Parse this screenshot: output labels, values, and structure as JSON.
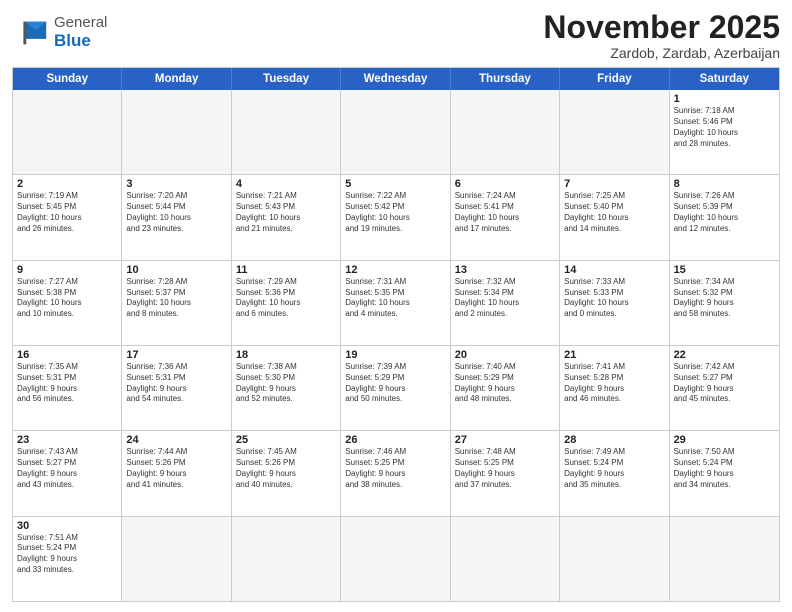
{
  "logo": {
    "general": "General",
    "blue": "Blue"
  },
  "title": {
    "month": "November 2025",
    "location": "Zardob, Zardab, Azerbaijan"
  },
  "weekdays": [
    "Sunday",
    "Monday",
    "Tuesday",
    "Wednesday",
    "Thursday",
    "Friday",
    "Saturday"
  ],
  "rows": [
    [
      {
        "day": "",
        "info": "",
        "empty": true
      },
      {
        "day": "",
        "info": "",
        "empty": true
      },
      {
        "day": "",
        "info": "",
        "empty": true
      },
      {
        "day": "",
        "info": "",
        "empty": true
      },
      {
        "day": "",
        "info": "",
        "empty": true
      },
      {
        "day": "",
        "info": "",
        "empty": true
      },
      {
        "day": "1",
        "info": "Sunrise: 7:18 AM\nSunset: 5:46 PM\nDaylight: 10 hours\nand 28 minutes.",
        "empty": false
      }
    ],
    [
      {
        "day": "2",
        "info": "Sunrise: 7:19 AM\nSunset: 5:45 PM\nDaylight: 10 hours\nand 26 minutes.",
        "empty": false
      },
      {
        "day": "3",
        "info": "Sunrise: 7:20 AM\nSunset: 5:44 PM\nDaylight: 10 hours\nand 23 minutes.",
        "empty": false
      },
      {
        "day": "4",
        "info": "Sunrise: 7:21 AM\nSunset: 5:43 PM\nDaylight: 10 hours\nand 21 minutes.",
        "empty": false
      },
      {
        "day": "5",
        "info": "Sunrise: 7:22 AM\nSunset: 5:42 PM\nDaylight: 10 hours\nand 19 minutes.",
        "empty": false
      },
      {
        "day": "6",
        "info": "Sunrise: 7:24 AM\nSunset: 5:41 PM\nDaylight: 10 hours\nand 17 minutes.",
        "empty": false
      },
      {
        "day": "7",
        "info": "Sunrise: 7:25 AM\nSunset: 5:40 PM\nDaylight: 10 hours\nand 14 minutes.",
        "empty": false
      },
      {
        "day": "8",
        "info": "Sunrise: 7:26 AM\nSunset: 5:39 PM\nDaylight: 10 hours\nand 12 minutes.",
        "empty": false
      }
    ],
    [
      {
        "day": "9",
        "info": "Sunrise: 7:27 AM\nSunset: 5:38 PM\nDaylight: 10 hours\nand 10 minutes.",
        "empty": false
      },
      {
        "day": "10",
        "info": "Sunrise: 7:28 AM\nSunset: 5:37 PM\nDaylight: 10 hours\nand 8 minutes.",
        "empty": false
      },
      {
        "day": "11",
        "info": "Sunrise: 7:29 AM\nSunset: 5:36 PM\nDaylight: 10 hours\nand 6 minutes.",
        "empty": false
      },
      {
        "day": "12",
        "info": "Sunrise: 7:31 AM\nSunset: 5:35 PM\nDaylight: 10 hours\nand 4 minutes.",
        "empty": false
      },
      {
        "day": "13",
        "info": "Sunrise: 7:32 AM\nSunset: 5:34 PM\nDaylight: 10 hours\nand 2 minutes.",
        "empty": false
      },
      {
        "day": "14",
        "info": "Sunrise: 7:33 AM\nSunset: 5:33 PM\nDaylight: 10 hours\nand 0 minutes.",
        "empty": false
      },
      {
        "day": "15",
        "info": "Sunrise: 7:34 AM\nSunset: 5:32 PM\nDaylight: 9 hours\nand 58 minutes.",
        "empty": false
      }
    ],
    [
      {
        "day": "16",
        "info": "Sunrise: 7:35 AM\nSunset: 5:31 PM\nDaylight: 9 hours\nand 56 minutes.",
        "empty": false
      },
      {
        "day": "17",
        "info": "Sunrise: 7:36 AM\nSunset: 5:31 PM\nDaylight: 9 hours\nand 54 minutes.",
        "empty": false
      },
      {
        "day": "18",
        "info": "Sunrise: 7:38 AM\nSunset: 5:30 PM\nDaylight: 9 hours\nand 52 minutes.",
        "empty": false
      },
      {
        "day": "19",
        "info": "Sunrise: 7:39 AM\nSunset: 5:29 PM\nDaylight: 9 hours\nand 50 minutes.",
        "empty": false
      },
      {
        "day": "20",
        "info": "Sunrise: 7:40 AM\nSunset: 5:29 PM\nDaylight: 9 hours\nand 48 minutes.",
        "empty": false
      },
      {
        "day": "21",
        "info": "Sunrise: 7:41 AM\nSunset: 5:28 PM\nDaylight: 9 hours\nand 46 minutes.",
        "empty": false
      },
      {
        "day": "22",
        "info": "Sunrise: 7:42 AM\nSunset: 5:27 PM\nDaylight: 9 hours\nand 45 minutes.",
        "empty": false
      }
    ],
    [
      {
        "day": "23",
        "info": "Sunrise: 7:43 AM\nSunset: 5:27 PM\nDaylight: 9 hours\nand 43 minutes.",
        "empty": false
      },
      {
        "day": "24",
        "info": "Sunrise: 7:44 AM\nSunset: 5:26 PM\nDaylight: 9 hours\nand 41 minutes.",
        "empty": false
      },
      {
        "day": "25",
        "info": "Sunrise: 7:45 AM\nSunset: 5:26 PM\nDaylight: 9 hours\nand 40 minutes.",
        "empty": false
      },
      {
        "day": "26",
        "info": "Sunrise: 7:46 AM\nSunset: 5:25 PM\nDaylight: 9 hours\nand 38 minutes.",
        "empty": false
      },
      {
        "day": "27",
        "info": "Sunrise: 7:48 AM\nSunset: 5:25 PM\nDaylight: 9 hours\nand 37 minutes.",
        "empty": false
      },
      {
        "day": "28",
        "info": "Sunrise: 7:49 AM\nSunset: 5:24 PM\nDaylight: 9 hours\nand 35 minutes.",
        "empty": false
      },
      {
        "day": "29",
        "info": "Sunrise: 7:50 AM\nSunset: 5:24 PM\nDaylight: 9 hours\nand 34 minutes.",
        "empty": false
      }
    ],
    [
      {
        "day": "30",
        "info": "Sunrise: 7:51 AM\nSunset: 5:24 PM\nDaylight: 9 hours\nand 33 minutes.",
        "empty": false
      },
      {
        "day": "",
        "info": "",
        "empty": true
      },
      {
        "day": "",
        "info": "",
        "empty": true
      },
      {
        "day": "",
        "info": "",
        "empty": true
      },
      {
        "day": "",
        "info": "",
        "empty": true
      },
      {
        "day": "",
        "info": "",
        "empty": true
      },
      {
        "day": "",
        "info": "",
        "empty": true
      }
    ]
  ]
}
